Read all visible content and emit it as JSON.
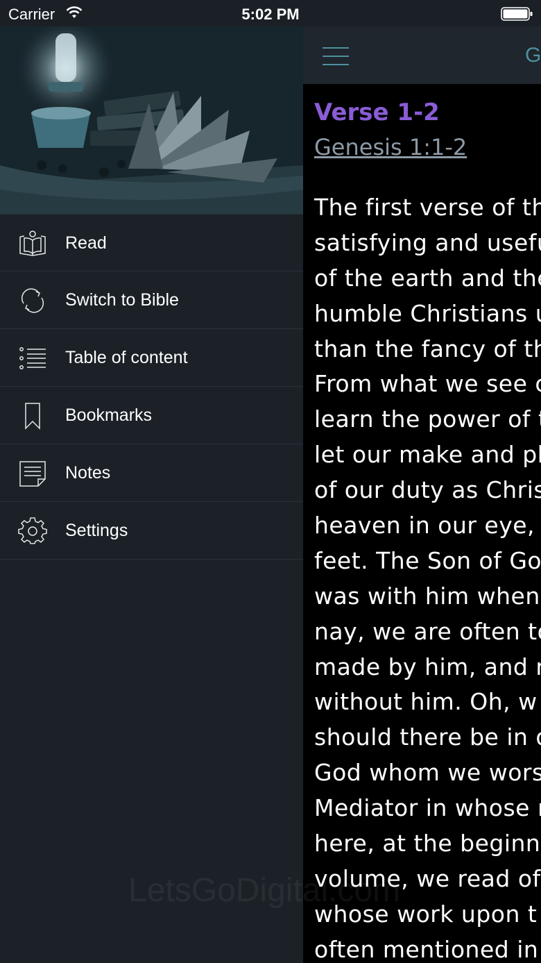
{
  "status_bar": {
    "carrier": "Carrier",
    "time": "5:02 PM",
    "wifi_icon": "wifi-icon",
    "battery_icon": "battery-icon"
  },
  "drawer": {
    "header_image": "book-and-lamp-illustration",
    "items": [
      {
        "label": "Read",
        "icon": "open-book-icon"
      },
      {
        "label": "Switch to Bible",
        "icon": "refresh-icon"
      },
      {
        "label": "Table of content",
        "icon": "list-icon"
      },
      {
        "label": "Bookmarks",
        "icon": "bookmark-icon"
      },
      {
        "label": "Notes",
        "icon": "note-icon"
      },
      {
        "label": "Settings",
        "icon": "gear-icon"
      }
    ]
  },
  "navbar": {
    "menu_icon": "hamburger-menu-icon",
    "title_partial": "G"
  },
  "verse": {
    "heading": "Verse 1-2",
    "reference": "Genesis 1:1-2",
    "lines": [
      "The first verse of th",
      "satisfying and usefu",
      "of the earth and the",
      "humble Christians u",
      "than the fancy of th",
      "From what we see c",
      "learn the power of t",
      "let our make and pl",
      "of our duty as Chris",
      "heaven in our eye, ",
      "feet. The Son of Go",
      "was with him when",
      "nay, we are often to",
      "made by him, and n",
      "without him. Oh, w",
      "should there be in o",
      "God whom we wors",
      "Mediator in whose n",
      "here, at the beginn",
      "volume, we read of",
      "whose work upon t",
      "often mentioned in"
    ]
  },
  "watermark": "LetsGoDigital.com",
  "colors": {
    "drawer_bg": "#1b2127",
    "content_bg": "#000000",
    "accent_teal": "#4f8fa0",
    "heading_purple": "#8a5cd6",
    "reference_gray": "#8c9aa6"
  }
}
